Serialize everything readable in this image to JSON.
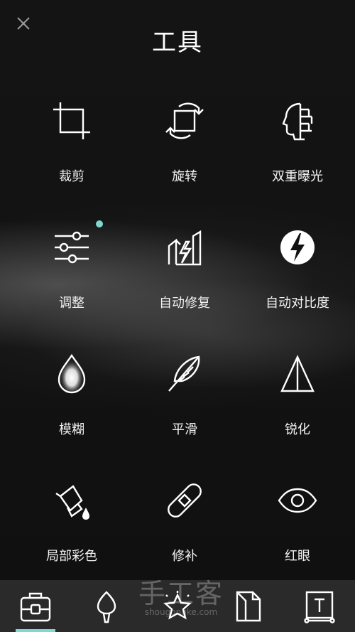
{
  "header": {
    "title": "工具",
    "close_icon": "close-icon"
  },
  "tools": [
    {
      "label": "裁剪",
      "icon": "crop-icon"
    },
    {
      "label": "旋转",
      "icon": "rotate-icon"
    },
    {
      "label": "双重曝光",
      "icon": "double-exposure-icon"
    },
    {
      "label": "调整",
      "icon": "tune-sliders-icon",
      "badge_color": "#7fd8cf"
    },
    {
      "label": "自动修复",
      "icon": "auto-fix-icon"
    },
    {
      "label": "自动对比度",
      "icon": "auto-contrast-icon"
    },
    {
      "label": "模糊",
      "icon": "blur-drop-icon"
    },
    {
      "label": "平滑",
      "icon": "smooth-feather-icon"
    },
    {
      "label": "锐化",
      "icon": "sharpen-triangle-icon"
    },
    {
      "label": "局部彩色",
      "icon": "paint-bucket-icon"
    },
    {
      "label": "修补",
      "icon": "bandage-icon"
    },
    {
      "label": "红眼",
      "icon": "eye-icon"
    }
  ],
  "toolbar": {
    "items": [
      {
        "icon": "toolbox-icon",
        "active": true
      },
      {
        "icon": "brush-icon"
      },
      {
        "icon": "sparkle-star-icon"
      },
      {
        "icon": "document-icon"
      },
      {
        "icon": "text-frame-icon"
      }
    ],
    "accent_color": "#7fd8cf"
  },
  "watermark": {
    "text": "手工客",
    "url": "shougongke.com"
  }
}
